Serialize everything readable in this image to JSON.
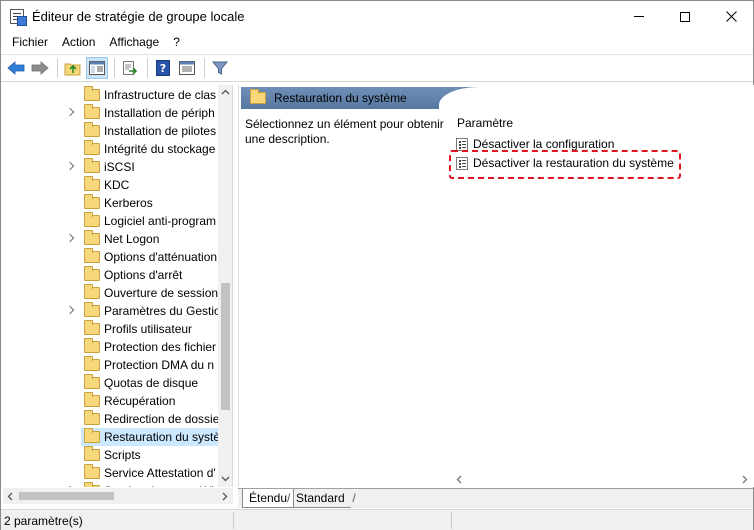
{
  "window": {
    "title": "Éditeur de stratégie de groupe locale"
  },
  "menu": {
    "items": [
      "Fichier",
      "Action",
      "Affichage",
      "?"
    ]
  },
  "toolbar": {
    "icons": [
      "back-icon",
      "forward-icon",
      "up-folder-icon",
      "show-hide-tree-icon",
      "export-list-icon",
      "help-icon",
      "properties-icon",
      "filter-icon"
    ]
  },
  "tree": {
    "items": [
      {
        "label": "Infrastructure de clas",
        "expandable": false
      },
      {
        "label": "Installation de périph",
        "expandable": true
      },
      {
        "label": "Installation de pilotes",
        "expandable": false
      },
      {
        "label": "Intégrité du stockage",
        "expandable": false
      },
      {
        "label": "iSCSI",
        "expandable": true
      },
      {
        "label": "KDC",
        "expandable": false
      },
      {
        "label": "Kerberos",
        "expandable": false
      },
      {
        "label": "Logiciel anti-program",
        "expandable": false
      },
      {
        "label": "Net Logon",
        "expandable": true
      },
      {
        "label": "Options d'atténuation",
        "expandable": false
      },
      {
        "label": "Options d'arrêt",
        "expandable": false
      },
      {
        "label": "Ouverture de session",
        "expandable": false
      },
      {
        "label": "Paramètres du Gestio",
        "expandable": true
      },
      {
        "label": "Profils utilisateur",
        "expandable": false
      },
      {
        "label": "Protection des fichier",
        "expandable": false
      },
      {
        "label": "Protection DMA du n",
        "expandable": false
      },
      {
        "label": "Quotas de disque",
        "expandable": false
      },
      {
        "label": "Récupération",
        "expandable": false
      },
      {
        "label": "Redirection de dossie",
        "expandable": false
      },
      {
        "label": "Restauration du systè",
        "expandable": false,
        "selected": true
      },
      {
        "label": "Scripts",
        "expandable": false
      },
      {
        "label": "Service Attestation d'",
        "expandable": false
      },
      {
        "label": "Service de temps Wi",
        "expandable": true
      }
    ]
  },
  "details": {
    "header_title": "Restauration du système",
    "description_lines": [
      "Sélectionnez un élément pour obtenir",
      "une description."
    ],
    "column_header": "Paramètre",
    "settings": [
      {
        "label": "Désactiver la configuration"
      },
      {
        "label": "Désactiver la restauration du système",
        "highlighted": true
      }
    ]
  },
  "tabs": {
    "extended": "Étendu",
    "standard": "Standard"
  },
  "status": {
    "text": "2 paramètre(s)"
  },
  "colors": {
    "selection": "#cce8ff",
    "highlight_border": "#e0141e",
    "header_band": "#5f80a9"
  }
}
